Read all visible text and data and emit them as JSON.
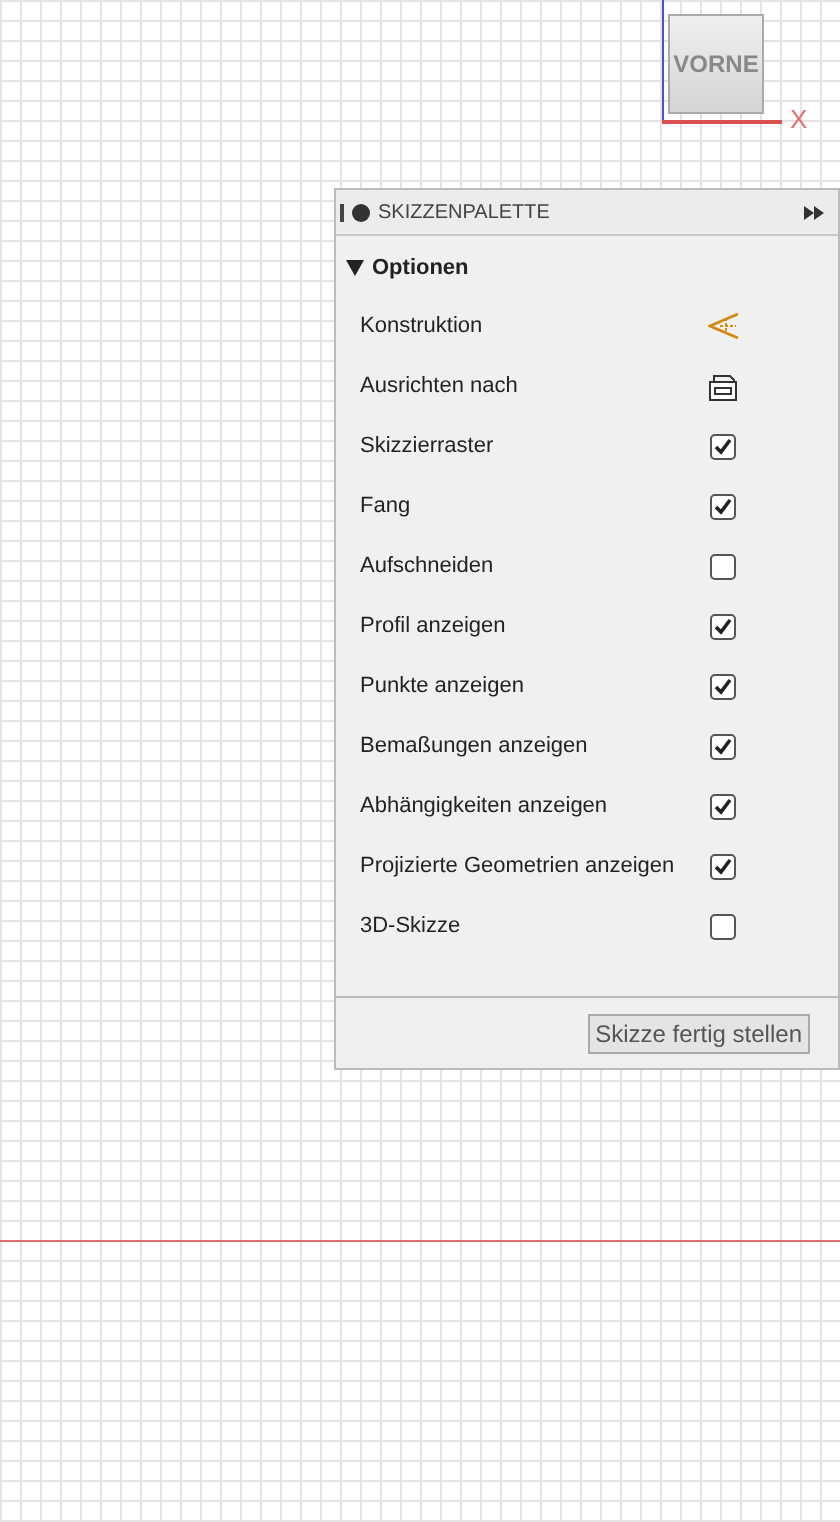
{
  "viewcube": {
    "face": "VORNE",
    "axis": "X"
  },
  "palette": {
    "title": "SKIZZENPALETTE",
    "section": {
      "label": "Optionen",
      "expanded": true
    },
    "options": [
      {
        "label": "Konstruktion",
        "kind": "construction"
      },
      {
        "label": "Ausrichten nach",
        "kind": "look-at"
      },
      {
        "label": "Skizzierraster",
        "kind": "checkbox",
        "checked": true
      },
      {
        "label": "Fang",
        "kind": "checkbox",
        "checked": true
      },
      {
        "label": "Aufschneiden",
        "kind": "checkbox",
        "checked": false
      },
      {
        "label": "Profil anzeigen",
        "kind": "checkbox",
        "checked": true
      },
      {
        "label": "Punkte anzeigen",
        "kind": "checkbox",
        "checked": true
      },
      {
        "label": "Bemaßungen anzeigen",
        "kind": "checkbox",
        "checked": true
      },
      {
        "label": "Abhängigkeiten anzeigen",
        "kind": "checkbox",
        "checked": true
      },
      {
        "label": "Projizierte Geometrien anzeigen",
        "kind": "checkbox",
        "checked": true
      },
      {
        "label": "3D-Skizze",
        "kind": "checkbox",
        "checked": false
      }
    ],
    "finish_button": "Skizze fertig stellen"
  }
}
